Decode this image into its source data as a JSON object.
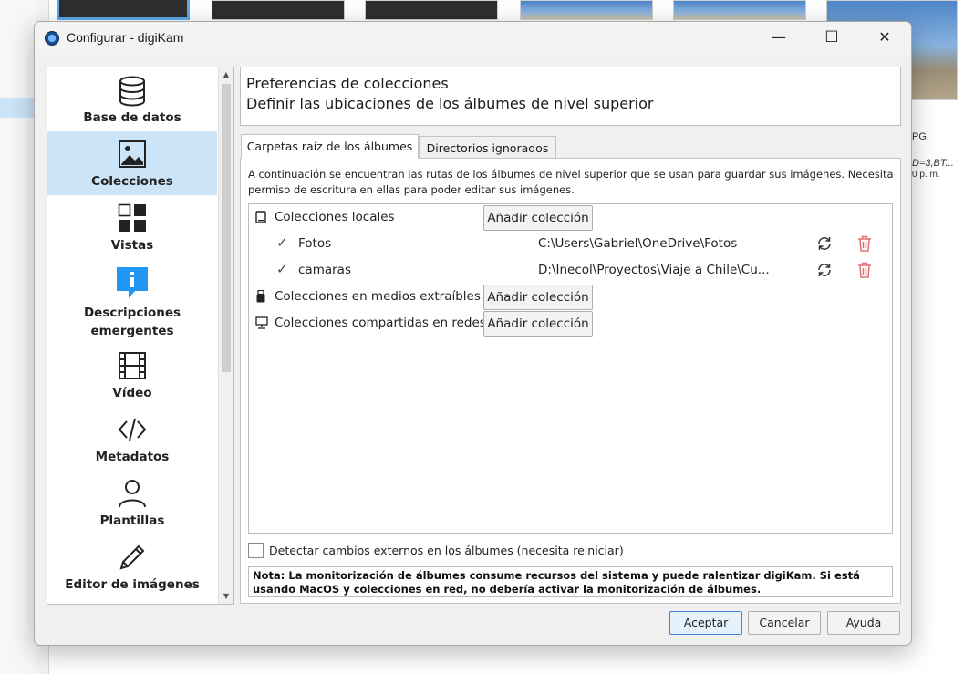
{
  "background": {
    "filename_fragment": "PG",
    "meta_line1": "D=3,BT...",
    "meta_line2": "0 p. m."
  },
  "window": {
    "title": "Configurar - digiKam",
    "minimize": "—",
    "maximize": "☐",
    "close": "✕"
  },
  "sidebar": {
    "items": [
      {
        "label": "Base de datos",
        "icon": "database-icon"
      },
      {
        "label": "Colecciones",
        "icon": "image-icon",
        "active": true
      },
      {
        "label": "Vistas",
        "icon": "views-grid-icon"
      },
      {
        "label": "Descripciones emergentes",
        "icon": "info-tooltip-icon"
      },
      {
        "label": "Vídeo",
        "icon": "film-icon"
      },
      {
        "label": "Metadatos",
        "icon": "code-icon"
      },
      {
        "label": "Plantillas",
        "icon": "person-icon"
      },
      {
        "label": "Editor de imágenes",
        "icon": "pencil-icon"
      }
    ]
  },
  "header": {
    "title": "Preferencias de colecciones",
    "subtitle": "Definir las ubicaciones de los álbumes de nivel superior"
  },
  "tabs": [
    {
      "label": "Carpetas raíz de los álbumes",
      "active": true
    },
    {
      "label": "Directorios ignorados",
      "active": false
    }
  ],
  "description": "A continuación se encuentran las rutas de los álbumes de nivel superior que se usan para guardar sus imágenes. Necesita permiso de escritura en ellas para poder editar sus imágenes.",
  "collections": {
    "add_label": "Añadir colección",
    "local": {
      "label": "Colecciones locales",
      "entries": [
        {
          "name": "Fotos",
          "path": "C:\\Users\\Gabriel\\OneDrive\\Fotos"
        },
        {
          "name": "camaras",
          "path": "D:\\Inecol\\Proyectos\\Viaje a Chile\\Cu..."
        }
      ]
    },
    "removable": {
      "label": "Colecciones en medios extraíbles"
    },
    "network": {
      "label": "Colecciones compartidas en redes"
    }
  },
  "detect_changes": {
    "label": "Detectar cambios externos en los álbumes (necesita reiniciar)",
    "checked": false
  },
  "note": "Nota: La monitorización de álbumes consume recursos del sistema y puede ralentizar digiKam. Si está usando MacOS y colecciones en red, no debería activar la monitorización de álbumes.",
  "buttons": {
    "accept": "Aceptar",
    "cancel": "Cancelar",
    "help": "Ayuda"
  },
  "colors": {
    "accent": "#cce4f7",
    "primary_border": "#3b86d6",
    "trash": "#e07070"
  }
}
